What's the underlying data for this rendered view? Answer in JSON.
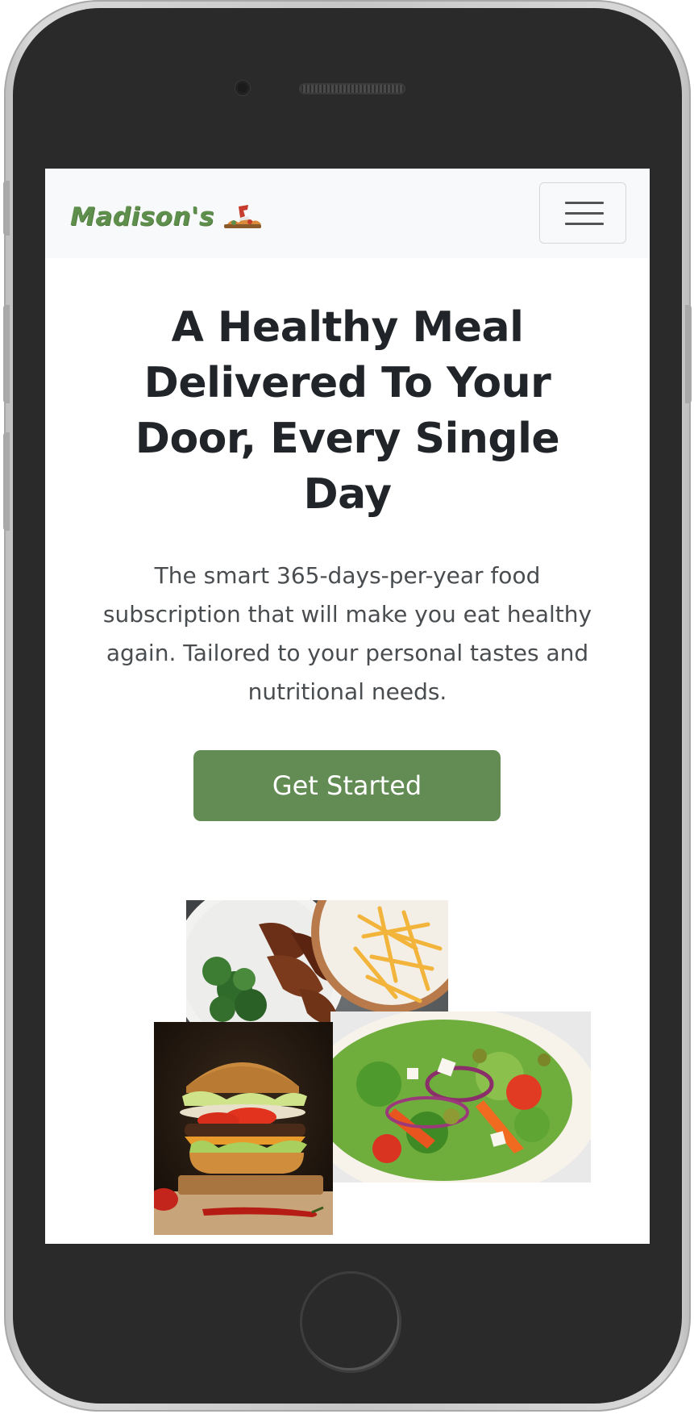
{
  "navbar": {
    "brand_text": "Madison's",
    "logo_icon": "food-delivery-logo",
    "menu_icon": "hamburger-menu-icon"
  },
  "hero": {
    "title": "A Healthy Meal Delivered To Your Door, Every Single Day",
    "subtitle": "The smart 365-days-per-year food subscription that will make you eat healthy again. Tailored to your personal tastes and nutritional needs.",
    "cta_label": "Get Started"
  },
  "images": [
    {
      "name": "chicken-broccoli-fries-photo"
    },
    {
      "name": "salad-photo"
    },
    {
      "name": "burger-photo"
    }
  ],
  "colors": {
    "brand_green": "#5f8f4c",
    "button_green": "#628c54",
    "navbar_bg": "#f8f9fa",
    "heading": "#212529",
    "device_body": "#2a2a2b"
  }
}
